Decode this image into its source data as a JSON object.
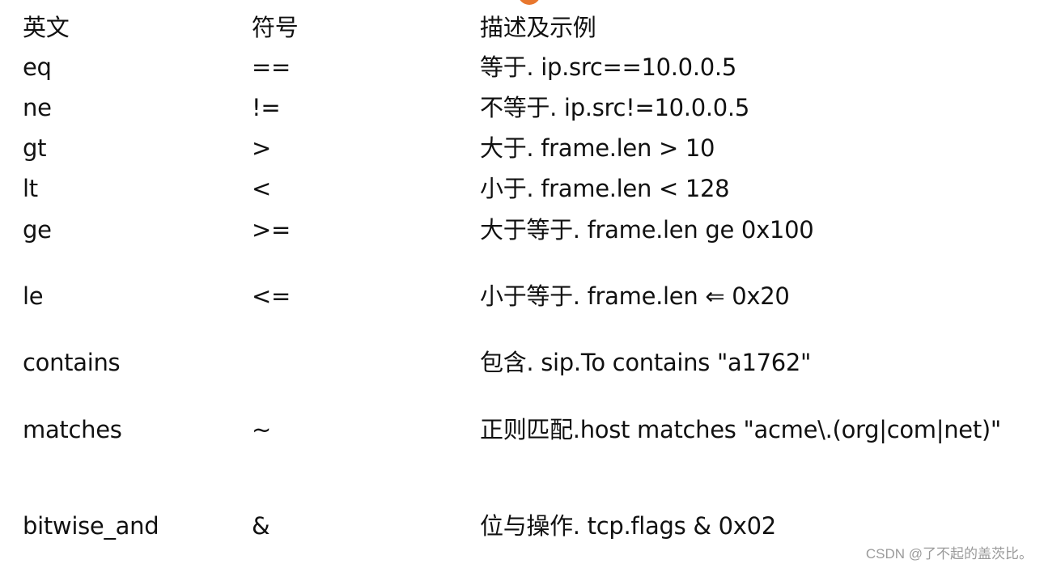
{
  "table": {
    "headers": [
      "英文",
      "符号",
      "描述及示例"
    ],
    "rows": [
      {
        "english": "eq",
        "symbol": "==",
        "description": "等于. ip.src==10.0.0.5"
      },
      {
        "english": "ne",
        "symbol": "!=",
        "description": "不等于. ip.src!=10.0.0.5"
      },
      {
        "english": "gt",
        "symbol": ">",
        "description": "大于. frame.len > 10"
      },
      {
        "english": "lt",
        "symbol": "<",
        "description": "小于. frame.len < 128"
      },
      {
        "english": "ge",
        "symbol": ">=",
        "description": "大于等于. frame.len ge 0x100"
      },
      {
        "english": "le",
        "symbol": "<=",
        "description": "小于等于. frame.len ⇐ 0x20"
      },
      {
        "english": "contains",
        "symbol": "",
        "description": "包含. sip.To contains \"a1762\""
      },
      {
        "english": "matches",
        "symbol": "~",
        "description": "正则匹配.host matches \"acme\\.(org|com|net)\""
      },
      {
        "english": "bitwise_and",
        "symbol": "&",
        "description": "位与操作. tcp.flags & 0x02"
      }
    ]
  },
  "watermark": "CSDN @了不起的盖茨比。",
  "icons": {
    "top_logo": "csdn-logo-icon"
  }
}
